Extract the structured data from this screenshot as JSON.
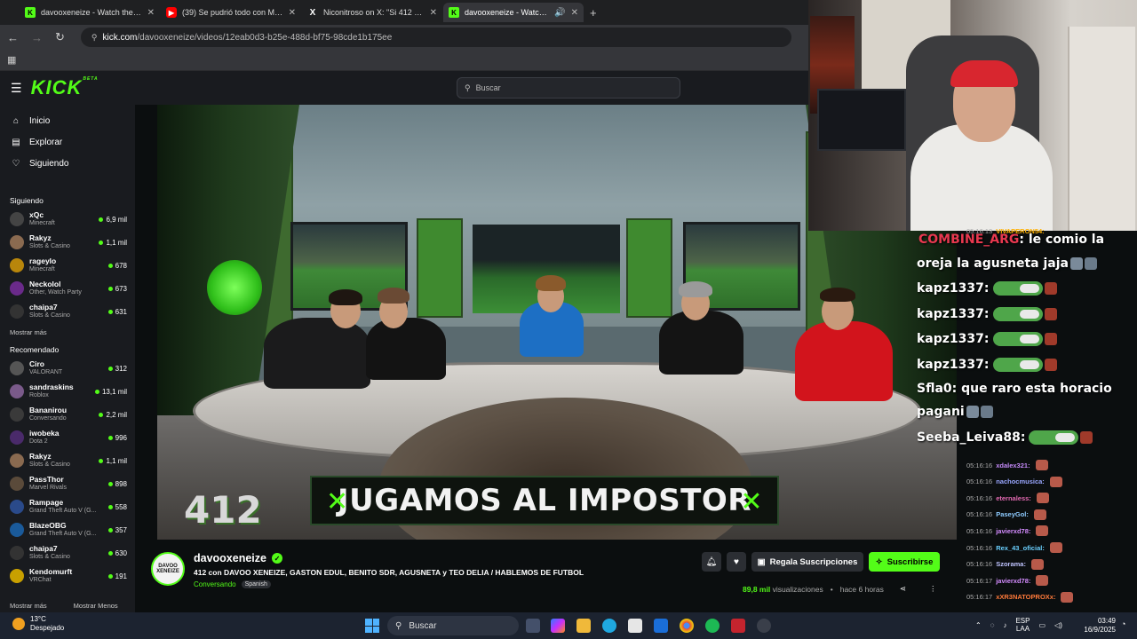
{
  "browser": {
    "tabs": [
      {
        "title": "davooxeneize - Watch the VOD",
        "favicon": "K"
      },
      {
        "title": "(39) Se pudrió todo con Mastan",
        "favicon": "▶"
      },
      {
        "title": "Niconitroso on X: \"Si 412 fuese",
        "favicon": "X"
      },
      {
        "title": "davooxeneize - Watch the V",
        "favicon": "K"
      }
    ],
    "new_tab": "+",
    "url_domain": "kick.com",
    "url_path": "/davooxeneize/videos/12eab0d3-b25e-488d-bf75-98cde1b175ee"
  },
  "kick": {
    "logo": "KICK",
    "beta": "BETA",
    "search_placeholder": "Buscar",
    "nav": [
      {
        "label": "Inicio",
        "icon": "⌂"
      },
      {
        "label": "Explorar",
        "icon": "▤"
      },
      {
        "label": "Siguiendo",
        "icon": "♡"
      }
    ],
    "following_title": "Siguiendo",
    "following": [
      {
        "name": "xQc",
        "category": "Minecraft",
        "viewers": "6,9 mil",
        "color": "#444"
      },
      {
        "name": "Rakyz",
        "category": "Slots & Casino",
        "viewers": "1,1 mil",
        "color": "#8a6a50"
      },
      {
        "name": "rageylo",
        "category": "Minecraft",
        "viewers": "678",
        "color": "#b8860b"
      },
      {
        "name": "Neckolol",
        "category": "Other, Watch Party",
        "viewers": "673",
        "color": "#6a2a8a"
      },
      {
        "name": "chaipa7",
        "category": "Slots & Casino",
        "viewers": "631",
        "color": "#333"
      }
    ],
    "show_more": "Mostrar más",
    "recommended_title": "Recomendado",
    "recommended": [
      {
        "name": "Ciro",
        "category": "VALORANT",
        "viewers": "312",
        "color": "#555"
      },
      {
        "name": "sandraskins",
        "category": "Roblox",
        "viewers": "13,1 mil",
        "color": "#7a5a8a"
      },
      {
        "name": "Bananirou",
        "category": "Conversando",
        "viewers": "2,2 mil",
        "color": "#3a3a3a"
      },
      {
        "name": "iwobeka",
        "category": "Dota 2",
        "viewers": "996",
        "color": "#4a2a6a"
      },
      {
        "name": "Rakyz",
        "category": "Slots & Casino",
        "viewers": "1,1 mil",
        "color": "#8a6a50"
      },
      {
        "name": "PassThor",
        "category": "Marvel Rivals",
        "viewers": "898",
        "color": "#5a4a3a"
      },
      {
        "name": "Rampage",
        "category": "Grand Theft Auto V (G...",
        "viewers": "558",
        "color": "#2a4a8a"
      },
      {
        "name": "BlazeOBG",
        "category": "Grand Theft Auto V (G...",
        "viewers": "357",
        "color": "#1a5a9a"
      },
      {
        "name": "chaipa7",
        "category": "Slots & Casino",
        "viewers": "630",
        "color": "#333"
      },
      {
        "name": "Kendomurft",
        "category": "VRChat",
        "viewers": "191",
        "color": "#c8a000"
      }
    ],
    "show_more_2": "Mostrar más",
    "show_less": "Mostrar Menos"
  },
  "video": {
    "banner": "JUGAMOS AL IMPOSTOR",
    "logo": "412"
  },
  "stream": {
    "avatar_text": "DAVOO XENEIZE",
    "channel": "davooxeneize",
    "title": "412 con DAVOO XENEIZE, GASTON EDUL, BENITO SDR, AGUSNETA y TEO DELIA / HABLEMOS DE FUTBOL",
    "category": "Conversando",
    "language": "Spanish",
    "gift_label": "Regala Suscripciones",
    "subscribe_label": "Suscribirse",
    "views_num": "89,8 mil",
    "views_label": "visualizaciones",
    "ago": "hace 6 horas"
  },
  "chat_big": [
    {
      "user": "COMBINE_ARG",
      "text": ": le comio la",
      "color": "#e8384f"
    },
    {
      "user": "",
      "text": "oreja la agusneta jaja",
      "color": "#fff"
    },
    {
      "user": "kapz1337",
      "text": ":",
      "color": "#fff"
    },
    {
      "user": "kapz1337",
      "text": ":",
      "color": "#fff"
    },
    {
      "user": "kapz1337",
      "text": ":",
      "color": "#fff"
    },
    {
      "user": "kapz1337",
      "text": ":",
      "color": "#fff"
    },
    {
      "user": "Sfla0",
      "text": ": que raro esta horacio",
      "color": "#fff"
    },
    {
      "user": "",
      "text": "pagani",
      "color": "#fff"
    },
    {
      "user": "Seeba_Leiva88",
      "text": ":",
      "color": "#fff"
    }
  ],
  "chat_top": {
    "time": "05:16:13",
    "user": "VIVAPERON54:"
  },
  "chat_small": [
    {
      "time": "05:16:16",
      "user": "xdalex321:",
      "color": "#c58af9"
    },
    {
      "time": "05:16:16",
      "user": "nachocmusica:",
      "color": "#9aa7ff"
    },
    {
      "time": "05:16:16",
      "user": "eternaless:",
      "color": "#e36ab2"
    },
    {
      "time": "05:16:16",
      "user": "PaseyGol:",
      "color": "#8ecbff"
    },
    {
      "time": "05:16:16",
      "user": "javierxd78:",
      "color": "#d48cff"
    },
    {
      "time": "05:16:16",
      "user": "Rex_43_oficial:",
      "color": "#6ad0ff"
    },
    {
      "time": "05:16:16",
      "user": "Szorama:",
      "color": "#c0c4ff"
    },
    {
      "time": "05:16:17",
      "user": "javierxd78:",
      "color": "#d48cff"
    },
    {
      "time": "05:16:17",
      "user": "xXR3NATOPROXx:",
      "color": "#ff7a3a"
    }
  ],
  "taskbar": {
    "temp": "13°C",
    "weather": "Despejado",
    "search": "Buscar",
    "lang1": "ESP",
    "lang2": "LAA",
    "time": "03:49",
    "date": "16/9/2025"
  }
}
